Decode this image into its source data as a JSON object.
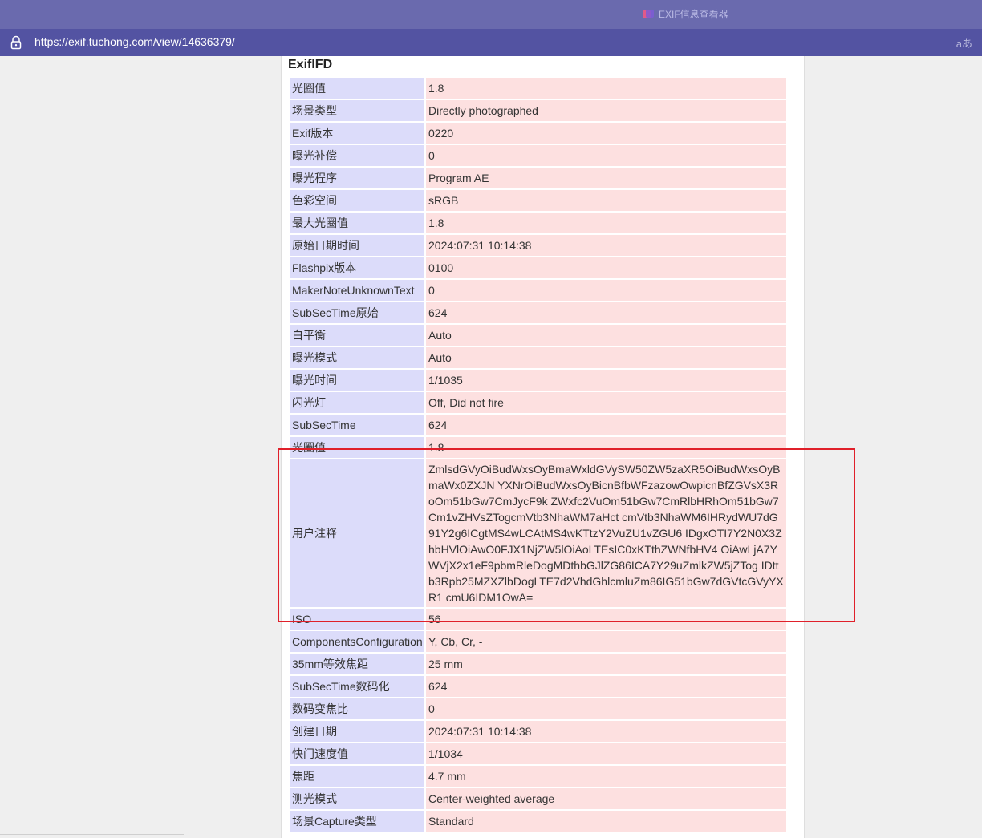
{
  "browser": {
    "tab_title": "EXIF信息查看器",
    "url": "https://exif.tuchong.com/view/14636379/",
    "translate_label": "aあ"
  },
  "section": {
    "title": "ExifIFD"
  },
  "rows": [
    {
      "key": "光圈值",
      "value": "1.8"
    },
    {
      "key": "场景类型",
      "value": "Directly photographed"
    },
    {
      "key": "Exif版本",
      "value": "0220"
    },
    {
      "key": "曝光补偿",
      "value": "0"
    },
    {
      "key": "曝光程序",
      "value": "Program AE"
    },
    {
      "key": "色彩空间",
      "value": "sRGB"
    },
    {
      "key": "最大光圈值",
      "value": "1.8"
    },
    {
      "key": "原始日期时间",
      "value": "2024:07:31 10:14:38"
    },
    {
      "key": "Flashpix版本",
      "value": "0100"
    },
    {
      "key": "MakerNoteUnknownText",
      "value": "0"
    },
    {
      "key": "SubSecTime原始",
      "value": "624"
    },
    {
      "key": "白平衡",
      "value": "Auto"
    },
    {
      "key": "曝光模式",
      "value": "Auto"
    },
    {
      "key": "曝光时间",
      "value": "1/1035"
    },
    {
      "key": "闪光灯",
      "value": "Off, Did not fire"
    },
    {
      "key": "SubSecTime",
      "value": "624"
    },
    {
      "key": "光圈值",
      "value": "1.8"
    },
    {
      "key": "用户注释",
      "value": "ZmlsdGVyOiBudWxsOyBmaWxldGVySW50ZW5zaXR5OiBudWxsOyBmaWx0ZXJN YXNrOiBudWxsOyBicnBfbWFzazowOwpicnBfZGVsX3RoOm51bGw7CmJycF9k ZWxfc2VuOm51bGw7CmRlbHRhOm51bGw7Cm1vZHVsZTogcmVtb3NhaWM7aHct cmVtb3NhaWM6IHRydWU7dG91Y2g6ICgtMS4wLCAtMS4wKTtzY2VuZU1vZGU6 IDgxOTI7Y2N0X3ZhbHVlOiAwO0FJX1NjZW5lOiAoLTEsIC0xKTthZWNfbHV4 OiAwLjA7YWVjX2x1eF9pbmRleDogMDthbGJlZG86ICA7Y29uZmlkZW5jZTog IDttb3Rpb25MZXZlbDogLTE7d2VhdGhlcmluZm86IG51bGw7dGVtcGVyYXR1 cmU6IDM1OwA="
    },
    {
      "key": "ISO",
      "value": "56"
    },
    {
      "key": "ComponentsConfiguration",
      "value": "Y, Cb, Cr, -"
    },
    {
      "key": "35mm等效焦距",
      "value": "25 mm"
    },
    {
      "key": "SubSecTime数码化",
      "value": "624"
    },
    {
      "key": "数码变焦比",
      "value": "0"
    },
    {
      "key": "创建日期",
      "value": "2024:07:31 10:14:38"
    },
    {
      "key": "快门速度值",
      "value": "1/1034"
    },
    {
      "key": "焦距",
      "value": "4.7 mm"
    },
    {
      "key": "测光模式",
      "value": "Center-weighted average"
    },
    {
      "key": "场景Capture类型",
      "value": "Standard"
    }
  ]
}
